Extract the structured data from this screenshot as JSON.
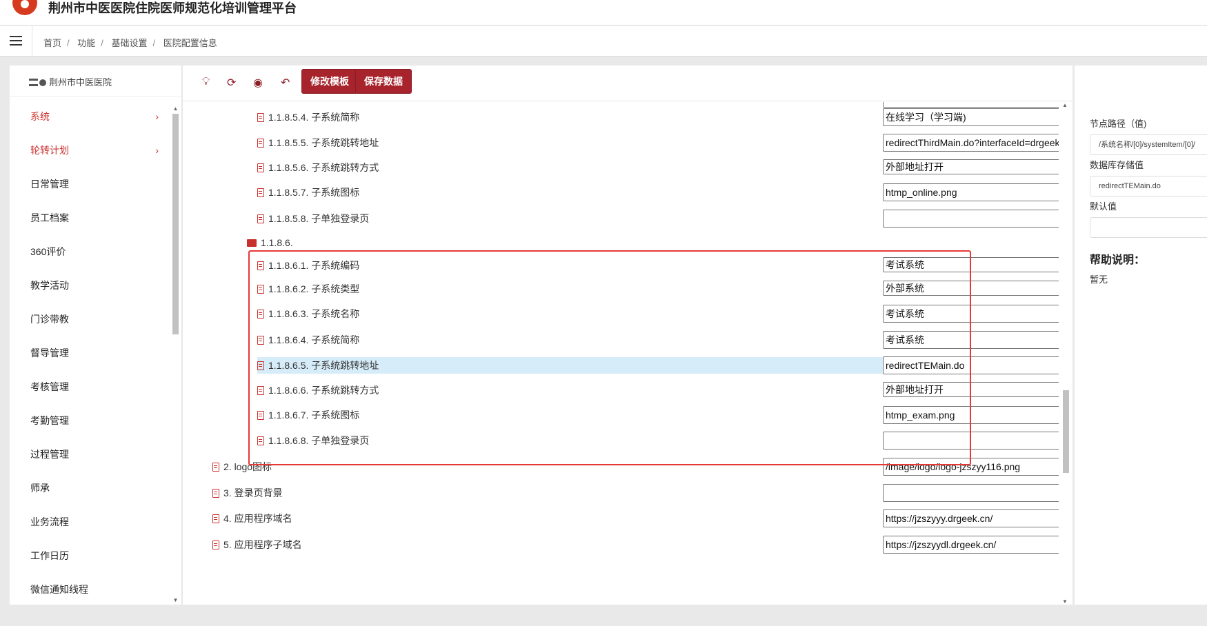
{
  "app": {
    "title": "荆州市中医医院住院医师规范化培训管理平台"
  },
  "breadcrumb": [
    "首页",
    "功能",
    "基础设置",
    "医院配置信息"
  ],
  "sidebar": {
    "hospital": "荆州市中医医院",
    "items": [
      {
        "label": "系统",
        "expandable": true
      },
      {
        "label": "轮转计划",
        "expandable": true
      },
      {
        "label": "日常管理"
      },
      {
        "label": "员工档案"
      },
      {
        "label": "360评价"
      },
      {
        "label": "教学活动"
      },
      {
        "label": "门诊带教"
      },
      {
        "label": "督导管理"
      },
      {
        "label": "考核管理"
      },
      {
        "label": "考勤管理"
      },
      {
        "label": "过程管理"
      },
      {
        "label": "师承"
      },
      {
        "label": "业务流程"
      },
      {
        "label": "工作日历"
      },
      {
        "label": "微信通知线程"
      }
    ]
  },
  "toolbar": {
    "icons": [
      "bulb-icon",
      "refresh-icon",
      "eye-icon",
      "undo-icon"
    ],
    "edit_template_label": "修改模板",
    "save_data_label": "保存数据"
  },
  "tree": {
    "rows": [
      {
        "label": "1.1.8.5.4. 子系统简称",
        "value": "在线学习（学习端)",
        "type": "input"
      },
      {
        "label": "1.1.8.5.5. 子系统跳转地址",
        "value": "redirectThirdMain.do?interfaceId=drgeek.cn_online_jzszyy'",
        "type": "input"
      },
      {
        "label": "1.1.8.5.6. 子系统跳转方式",
        "value": "外部地址打开",
        "type": "select"
      },
      {
        "label": "1.1.8.5.7. 子系统图标",
        "value": "htmp_online.png",
        "type": "input"
      },
      {
        "label": "1.1.8.5.8. 子单独登录页",
        "value": "",
        "type": "input"
      },
      {
        "label": "1.1.8.6.",
        "type": "folder"
      },
      {
        "label": "1.1.8.6.1. 子系统编码",
        "value": "考试系统",
        "type": "select"
      },
      {
        "label": "1.1.8.6.2. 子系统类型",
        "value": "外部系统",
        "type": "select"
      },
      {
        "label": "1.1.8.6.3. 子系统名称",
        "value": "考试系统",
        "type": "input"
      },
      {
        "label": "1.1.8.6.4. 子系统简称",
        "value": "考试系统",
        "type": "input"
      },
      {
        "label": "1.1.8.6.5. 子系统跳转地址",
        "value": "redirectTEMain.do",
        "type": "input",
        "selected": true
      },
      {
        "label": "1.1.8.6.6. 子系统跳转方式",
        "value": "外部地址打开",
        "type": "select"
      },
      {
        "label": "1.1.8.6.7. 子系统图标",
        "value": "htmp_exam.png",
        "type": "input"
      },
      {
        "label": "1.1.8.6.8. 子单独登录页",
        "value": "",
        "type": "input"
      },
      {
        "label": "2. logo图标",
        "value": "/image/logo/logo-jzszyy116.png",
        "type": "input"
      },
      {
        "label": "3. 登录页背景",
        "value": "",
        "type": "input"
      },
      {
        "label": "4. 应用程序域名",
        "value": "https://jzszyyy.drgeek.cn/",
        "type": "input"
      },
      {
        "label": "5. 应用程序子域名",
        "value": "https://jzszyydl.drgeek.cn/",
        "type": "input"
      }
    ]
  },
  "right_panel": {
    "node_path_label": "节点路径（值)",
    "node_path_value": "/系统名称/[0]/systemItem/[0]/",
    "db_value_label": "数据库存储值",
    "db_value": "redirectTEMain.do",
    "default_label": "默认值",
    "default_value": "",
    "help_title": "帮助说明：",
    "help_text": "暂无"
  },
  "colors": {
    "accent": "#a8242c",
    "highlight_border": "#e53935",
    "selected_row": "#d6ecf8"
  }
}
